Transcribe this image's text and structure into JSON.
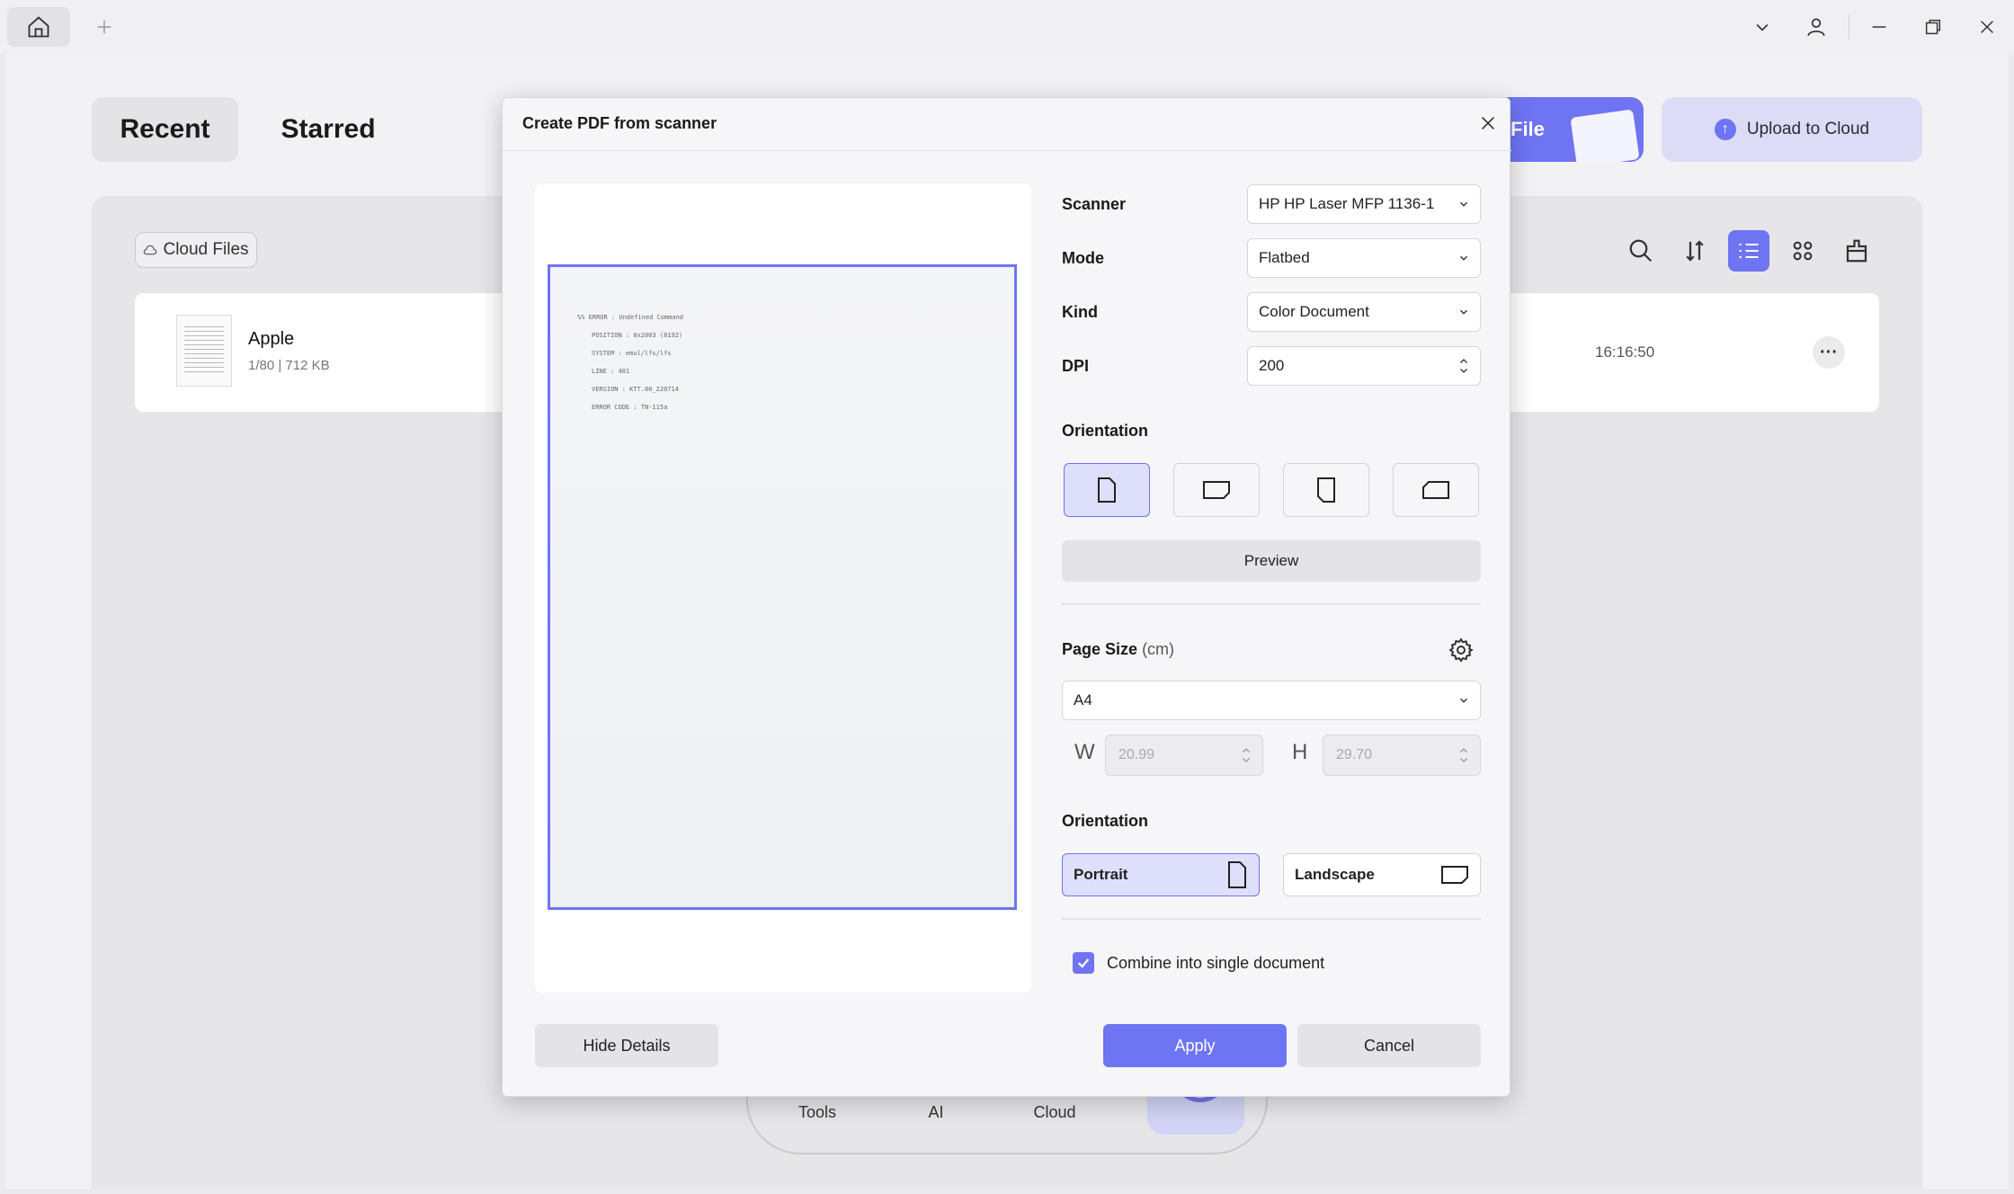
{
  "titlebar": {
    "icons": [
      "home-icon",
      "plus-icon",
      "chevron-down-icon",
      "user-icon",
      "minimize-icon",
      "restore-icon",
      "close-icon"
    ]
  },
  "home": {
    "tabs": [
      {
        "label": "Recent"
      },
      {
        "label": "Starred"
      }
    ],
    "open_file_label": "File",
    "upload_label": "Upload to Cloud",
    "cloud_chip": "Cloud Files",
    "toolbar_icons": [
      "search-icon",
      "sort-icon",
      "list-view-icon",
      "grid-view-icon",
      "clear-icon"
    ],
    "files": [
      {
        "name": "Apple",
        "meta": "1/80 | 712 KB",
        "time": "16:16:50"
      }
    ],
    "bottom_buttons": [
      "Tools",
      "AI",
      "Cloud"
    ]
  },
  "dialog": {
    "title": "Create PDF from scanner",
    "preview_lines": [
      "%% ERROR : Undefined Command",
      "POSITION : 0x2003 (8192)",
      "SYSTEM   : emul/lfs/lfs",
      "LINE     :   401",
      "VERSION  : KTT.00_220714",
      "ERROR CODE : TN-115a"
    ],
    "scanner": {
      "label": "Scanner",
      "value": "HP HP Laser MFP 1136-1"
    },
    "mode": {
      "label": "Mode",
      "value": "Flatbed"
    },
    "kind": {
      "label": "Kind",
      "value": "Color Document"
    },
    "dpi": {
      "label": "DPI",
      "value": "200"
    },
    "orientation_label": "Orientation",
    "orientation_selected_index": 0,
    "preview_button": "Preview",
    "page_size": {
      "label": "Page Size",
      "unit": "(cm)",
      "value": "A4"
    },
    "width": {
      "label": "W",
      "value": "20.99"
    },
    "height": {
      "label": "H",
      "value": "29.70"
    },
    "page_orientation": {
      "label": "Orientation",
      "portrait": "Portrait",
      "landscape": "Landscape",
      "selected": "Portrait"
    },
    "combine": {
      "label": "Combine into single document",
      "checked": true
    },
    "hide_details": "Hide Details",
    "apply": "Apply",
    "cancel": "Cancel"
  },
  "colors": {
    "accent": "#6f74f2",
    "accent_light": "#dedffa"
  }
}
